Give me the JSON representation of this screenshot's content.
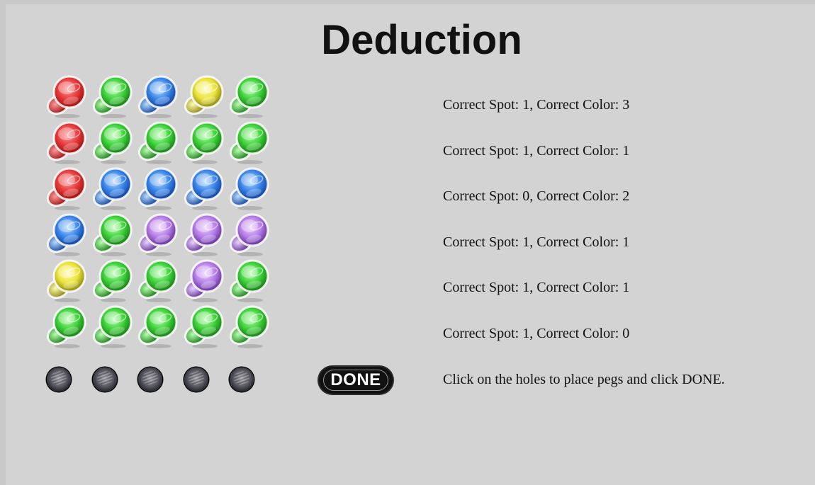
{
  "title": "Deduction",
  "palette": {
    "red": {
      "light": "#ff9a9a",
      "base": "#e83a3a",
      "dark": "#9a1010"
    },
    "green": {
      "light": "#b8ffb0",
      "base": "#3ed23a",
      "dark": "#167a14"
    },
    "blue": {
      "light": "#b8dcff",
      "base": "#3a86ea",
      "dark": "#0f3f9a"
    },
    "yellow": {
      "light": "#fffcb0",
      "base": "#ebe43a",
      "dark": "#8c8410"
    },
    "purple": {
      "light": "#ecd2ff",
      "base": "#b77ee8",
      "dark": "#5f2f96"
    }
  },
  "guesses": [
    {
      "pegs": [
        "red",
        "green",
        "blue",
        "yellow",
        "green"
      ],
      "feedback": "Correct Spot: 1, Correct Color: 3"
    },
    {
      "pegs": [
        "red",
        "green",
        "green",
        "green",
        "green"
      ],
      "feedback": "Correct Spot: 1, Correct Color: 1"
    },
    {
      "pegs": [
        "red",
        "blue",
        "blue",
        "blue",
        "blue"
      ],
      "feedback": "Correct Spot: 0, Correct Color: 2"
    },
    {
      "pegs": [
        "blue",
        "green",
        "purple",
        "purple",
        "purple"
      ],
      "feedback": "Correct Spot: 1, Correct Color: 1"
    },
    {
      "pegs": [
        "yellow",
        "green",
        "green",
        "purple",
        "green"
      ],
      "feedback": "Correct Spot: 1, Correct Color: 1"
    },
    {
      "pegs": [
        "green",
        "green",
        "green",
        "green",
        "green"
      ],
      "feedback": "Correct Spot: 1, Correct Color: 0"
    }
  ],
  "current_row": {
    "holes": [
      "empty",
      "empty",
      "empty",
      "empty",
      "empty"
    ]
  },
  "done_button": {
    "label": "DONE"
  },
  "instructions": "Click on the holes to place pegs and click DONE."
}
